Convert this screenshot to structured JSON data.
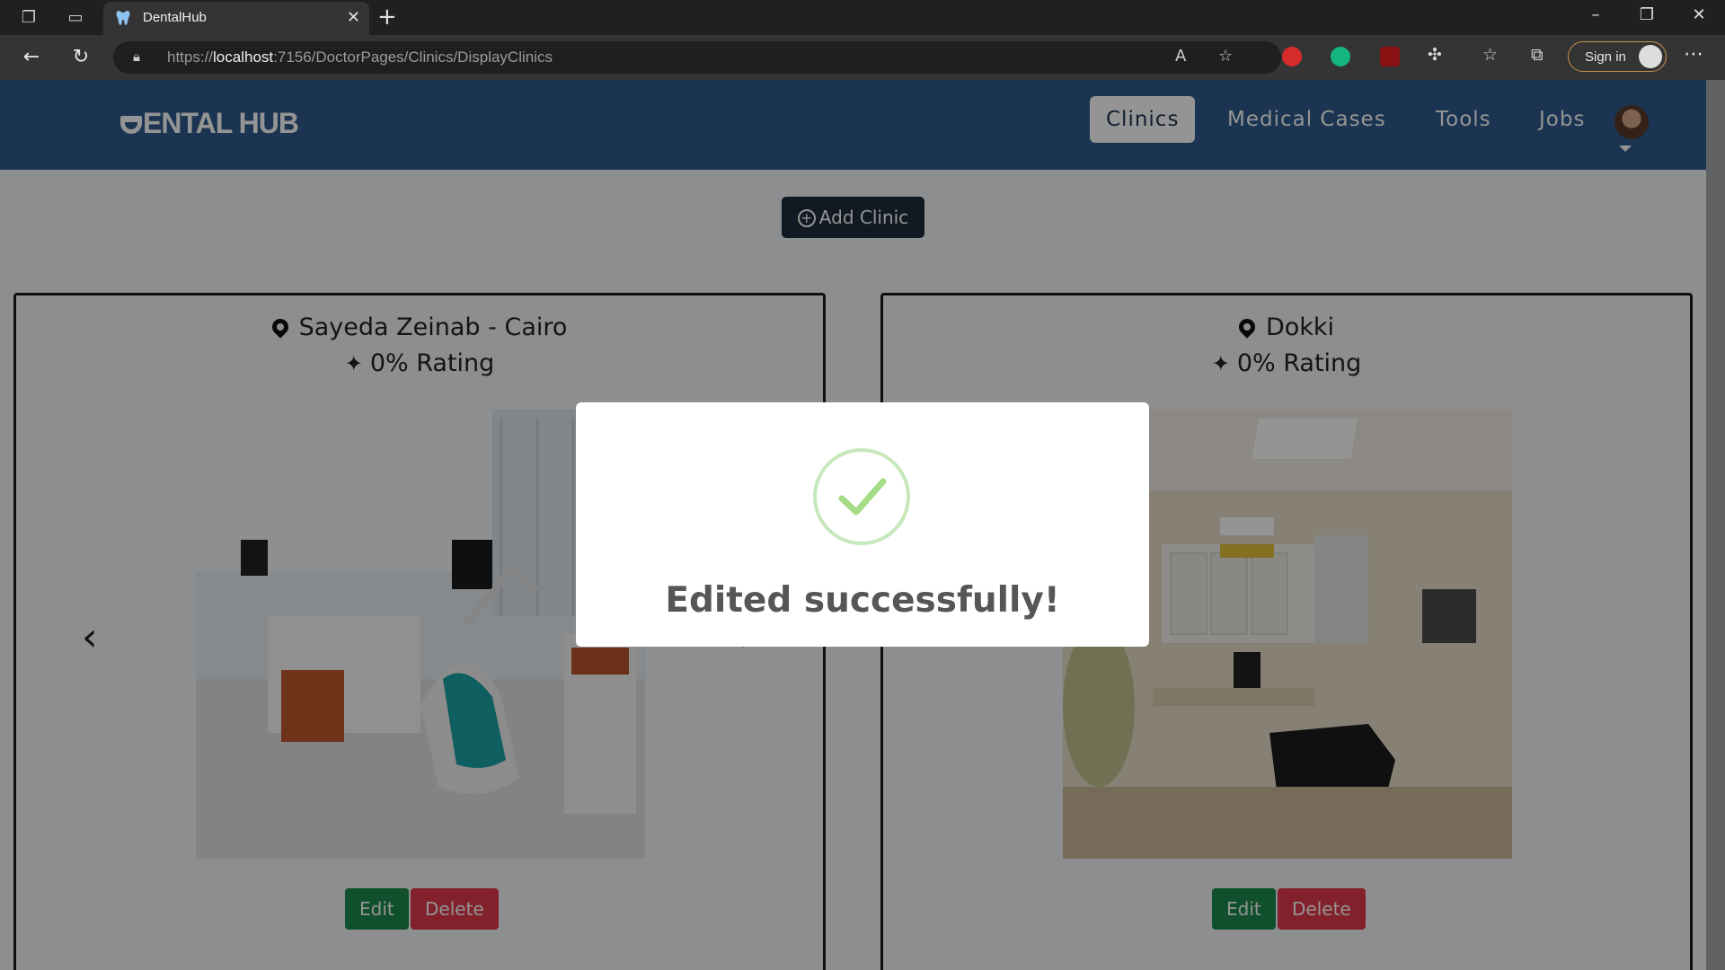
{
  "browser": {
    "tab_title": "DentalHub",
    "url_prefix": "https://",
    "url_host": "localhost",
    "url_path": ":7156/DoctorPages/Clinics/DisplayClinics",
    "signin_label": "Sign in"
  },
  "navbar": {
    "logo_text": "ENTAL HUB",
    "links": [
      "Clinics",
      "Medical Cases",
      "Tools",
      "Jobs"
    ],
    "active": "Clinics",
    "colors": {
      "bar": "#2d5a8c",
      "active_bg": "#ffffff"
    }
  },
  "actions": {
    "add_clinic_label": "Add Clinic"
  },
  "clinics": [
    {
      "location": "Sayeda Zeinab - Cairo",
      "rating": "0% Rating",
      "edit_label": "Edit",
      "delete_label": "Delete",
      "photo": "dental operatory with teal chair"
    },
    {
      "location": "Dokki",
      "rating": "0% Rating",
      "edit_label": "Edit",
      "delete_label": "Delete",
      "photo": "exam room with black exam table"
    }
  ],
  "modal": {
    "message": "Edited successfully!",
    "icon": "success-check-icon",
    "color": "#a5dc86"
  }
}
